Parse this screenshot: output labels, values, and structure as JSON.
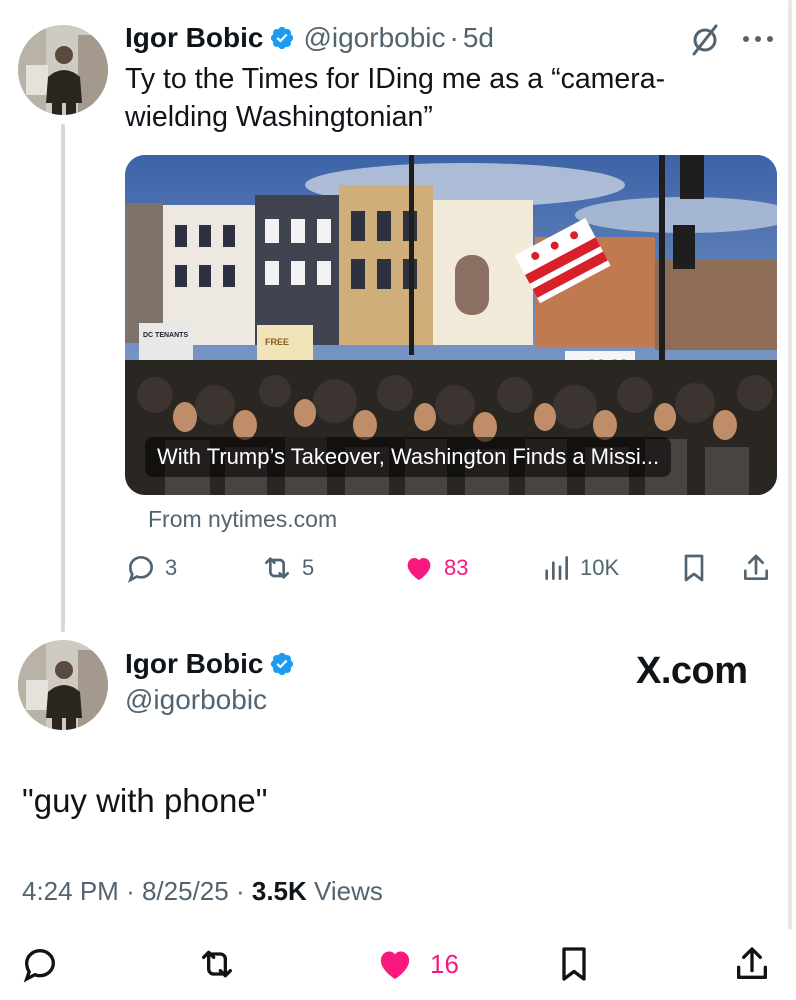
{
  "tweet1": {
    "name": "Igor Bobic",
    "handle": "@igorbobic",
    "separator": "·",
    "age": "5d",
    "text": "Ty to the Times for IDing me as a “camera-wielding Washingtonian”",
    "card": {
      "title": "With Trump’s Takeover, Washington Finds a Missi...",
      "from": "From nytimes.com",
      "image_text": [
        "DC TENANTS",
        "FREE",
        "GO-GO"
      ]
    },
    "actions": {
      "replies": "3",
      "reposts": "5",
      "likes": "83",
      "views": "10K"
    }
  },
  "tweet2": {
    "name": "Igor Bobic",
    "handle": "@igorbobic",
    "brand": "X.com",
    "text": "\"guy with phone\"",
    "time": "4:24 PM",
    "date": "8/25/25",
    "separator": "·",
    "views_count": "3.5K",
    "views_label": "Views",
    "likes": "16"
  },
  "colors": {
    "text_primary": "#0f1419",
    "text_secondary": "#536471",
    "verified": "#1d9bf0",
    "like": "#f91880",
    "thread_line": "#cfd9de"
  },
  "icons": [
    "verified-badge-icon",
    "grok-icon",
    "more-icon",
    "reply-icon",
    "repost-icon",
    "like-icon",
    "views-icon",
    "bookmark-icon",
    "share-icon"
  ]
}
